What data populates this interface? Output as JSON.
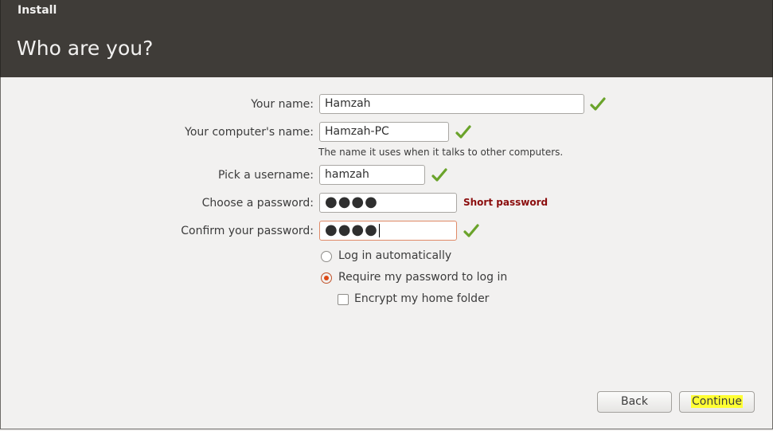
{
  "window": {
    "title": "Install"
  },
  "page": {
    "heading": "Who are you?"
  },
  "form": {
    "name_label": "Your name:",
    "name_value": "Hamzah",
    "computer_label": "Your computer's name:",
    "computer_value": "Hamzah-PC",
    "computer_hint": "The name it uses when it talks to other computers.",
    "username_label": "Pick a username:",
    "username_value": "hamzah",
    "password_label": "Choose a password:",
    "password_value": "●●●●",
    "password_strength": "Short password",
    "confirm_label": "Confirm your password:",
    "confirm_value": "●●●●"
  },
  "options": {
    "auto_login": "Log in automatically",
    "require_password": "Require my password to log in",
    "encrypt_home": "Encrypt my home folder",
    "selected": "require_password",
    "encrypt_checked": false
  },
  "buttons": {
    "back": "Back",
    "continue": "Continue"
  },
  "colors": {
    "header": "#3f3c38",
    "accent": "#dd4814",
    "check": "#6aa32a",
    "warning": "#8b0d0d",
    "highlight": "#ffff33"
  },
  "icons": {
    "valid": "check-icon"
  }
}
